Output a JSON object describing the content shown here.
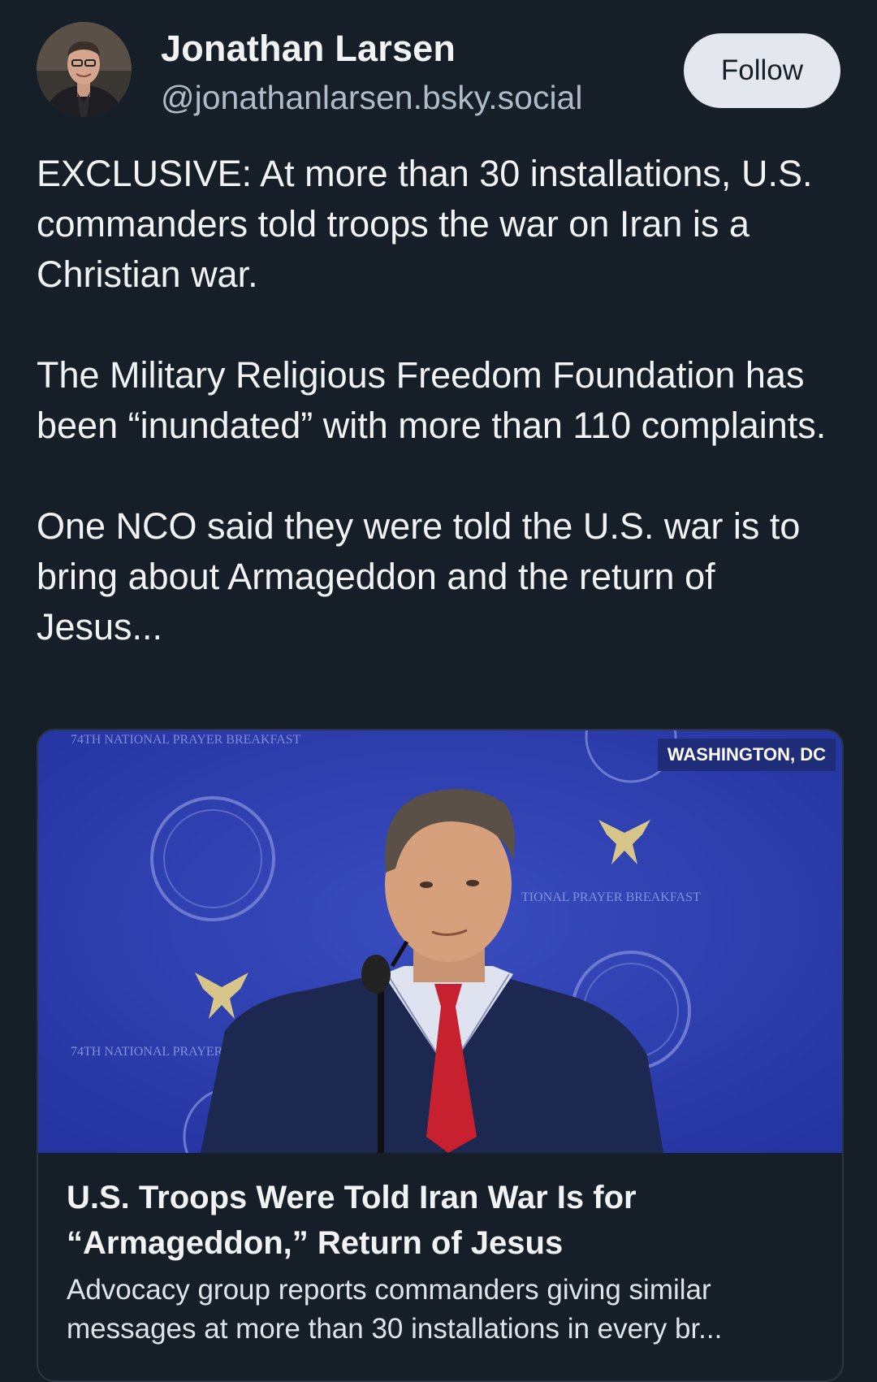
{
  "author": {
    "name": "Jonathan Larsen",
    "handle": "@jonathanlarsen.bsky.social",
    "avatar_icon": "profile-photo"
  },
  "follow_label": "Follow",
  "post": {
    "paragraphs": [
      "EXCLUSIVE: At more than 30 installations, U.S. commanders told troops the war on Iran is a Christian war.",
      "The Military Religious Freedom Foundation has been “inundated” with more than 110 complaints.",
      "One NCO said they were told the U.S. war is to bring about Armageddon and the return of Jesus..."
    ]
  },
  "card": {
    "location_tag": "WASHINGTON, DC",
    "title": "U.S. Troops Were Told Iran War Is for “Armageddon,” Return of Jesus",
    "description": "Advocacy group reports commanders giving similar messages at more than 30 installations in every br..."
  },
  "colors": {
    "background": "#161e27",
    "text": "#f1f3f5",
    "handle": "#aebbc9",
    "follow_bg": "#e4e8ee",
    "card_border": "#2a3543"
  }
}
